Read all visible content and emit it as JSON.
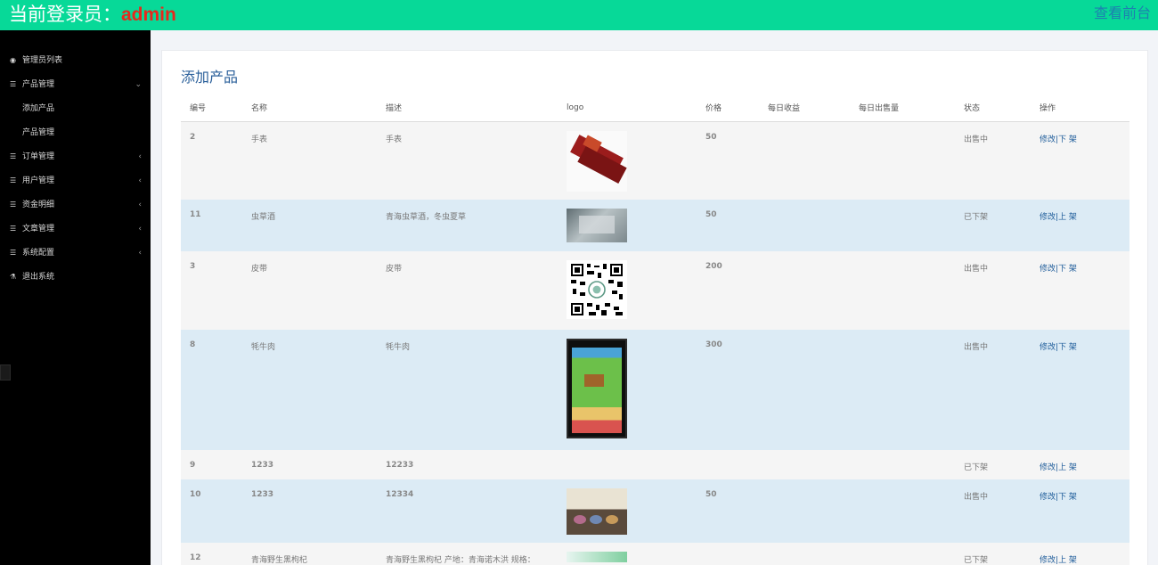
{
  "header": {
    "login_label": "当前登录员：",
    "admin_name": "admin",
    "front_link": "查看前台"
  },
  "sidebar": {
    "items": [
      {
        "label": "管理员列表",
        "icon": "dashboard-icon",
        "arrow": ""
      },
      {
        "label": "产品管理",
        "icon": "list-icon",
        "arrow": "⌄"
      },
      {
        "label": "订单管理",
        "icon": "list-icon",
        "arrow": "‹"
      },
      {
        "label": "用户管理",
        "icon": "list-icon",
        "arrow": "‹"
      },
      {
        "label": "资金明细",
        "icon": "list-icon",
        "arrow": "‹"
      },
      {
        "label": "文章管理",
        "icon": "list-icon",
        "arrow": "‹"
      },
      {
        "label": "系统配置",
        "icon": "list-icon",
        "arrow": "‹"
      },
      {
        "label": "退出系统",
        "icon": "flask-icon",
        "arrow": ""
      }
    ],
    "sub_items": [
      {
        "label": "添加产品"
      },
      {
        "label": "产品管理"
      }
    ]
  },
  "main": {
    "title": "添加产品",
    "columns": [
      "编号",
      "名称",
      "描述",
      "logo",
      "价格",
      "每日收益",
      "每日出售量",
      "状态",
      "操作"
    ],
    "rows": [
      {
        "id": "2",
        "name": "手表",
        "desc": "手表",
        "logo": "product-box-image",
        "price": "50",
        "daily_income": "",
        "daily_sales": "",
        "status": "出售中",
        "edit": "修改",
        "sep": "|",
        "toggle": "下 架"
      },
      {
        "id": "11",
        "name": "虫草酒",
        "desc": "青海虫草酒，冬虫夏草",
        "logo": "document-photo-image",
        "price": "50",
        "daily_income": "",
        "daily_sales": "",
        "status": "已下架",
        "edit": "修改",
        "sep": "|",
        "toggle": "上 架"
      },
      {
        "id": "3",
        "name": "皮带",
        "desc": "皮带",
        "logo": "qr-code-image",
        "price": "200",
        "daily_income": "",
        "daily_sales": "",
        "status": "出售中",
        "edit": "修改",
        "sep": "|",
        "toggle": "下 架"
      },
      {
        "id": "8",
        "name": "牦牛肉",
        "desc": "牦牛肉",
        "logo": "phone-screenshot-image",
        "price": "300",
        "daily_income": "",
        "daily_sales": "",
        "status": "出售中",
        "edit": "修改",
        "sep": "|",
        "toggle": "下 架"
      },
      {
        "id": "9",
        "name": "1233",
        "desc": "12233",
        "logo": "",
        "price": "",
        "daily_income": "",
        "daily_sales": "",
        "status": "已下架",
        "edit": "修改",
        "sep": "|",
        "toggle": "上 架"
      },
      {
        "id": "10",
        "name": "1233",
        "desc": "12334",
        "logo": "jewelry-photo-image",
        "price": "50",
        "daily_income": "",
        "daily_sales": "",
        "status": "出售中",
        "edit": "修改",
        "sep": "|",
        "toggle": "下 架"
      },
      {
        "id": "12",
        "name": "青海野生黑枸杞",
        "desc": "青海野生黑枸杞 产地：青海诺木洪 规格：",
        "logo": "banner-image",
        "price": "",
        "daily_income": "",
        "daily_sales": "",
        "status": "已下架",
        "edit": "修改",
        "sep": "|",
        "toggle": "上 架"
      }
    ]
  },
  "colors": {
    "topbar": "#07d998",
    "admin_name": "#e8281c",
    "link": "#1e5c9a",
    "row_alt": "#dcebf5"
  }
}
